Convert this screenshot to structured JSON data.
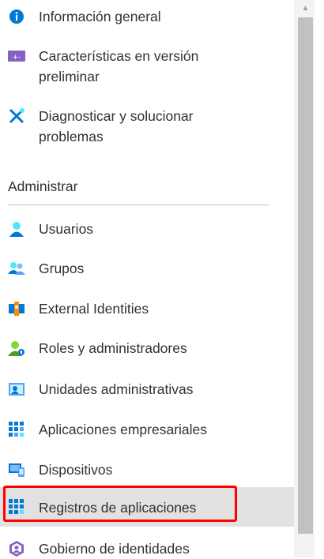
{
  "menu": {
    "items": [
      {
        "id": "info",
        "label": "Información general"
      },
      {
        "id": "preview",
        "label": "Características en versión\npreliminar"
      },
      {
        "id": "diag",
        "label": "Diagnosticar y solucionar\nproblemas"
      }
    ],
    "section_title": "Administrar",
    "admin_items": [
      {
        "id": "users",
        "label": "Usuarios"
      },
      {
        "id": "groups",
        "label": "Grupos"
      },
      {
        "id": "external",
        "label": "External Identities"
      },
      {
        "id": "roles",
        "label": "Roles y administradores"
      },
      {
        "id": "units",
        "label": "Unidades administrativas"
      },
      {
        "id": "enterprise",
        "label": "Aplicaciones empresariales"
      },
      {
        "id": "devices",
        "label": "Dispositivos"
      },
      {
        "id": "appreg",
        "label": "Registros de aplicaciones"
      },
      {
        "id": "governance",
        "label": "Gobierno de identidades"
      }
    ],
    "selected_item": "Registros de aplicaciones"
  },
  "scrollbar": {
    "up_arrow": "▲"
  },
  "colors": {
    "accent": "#0078d4",
    "highlight": "#ff0000",
    "selected_bg": "#e1e1e1"
  }
}
